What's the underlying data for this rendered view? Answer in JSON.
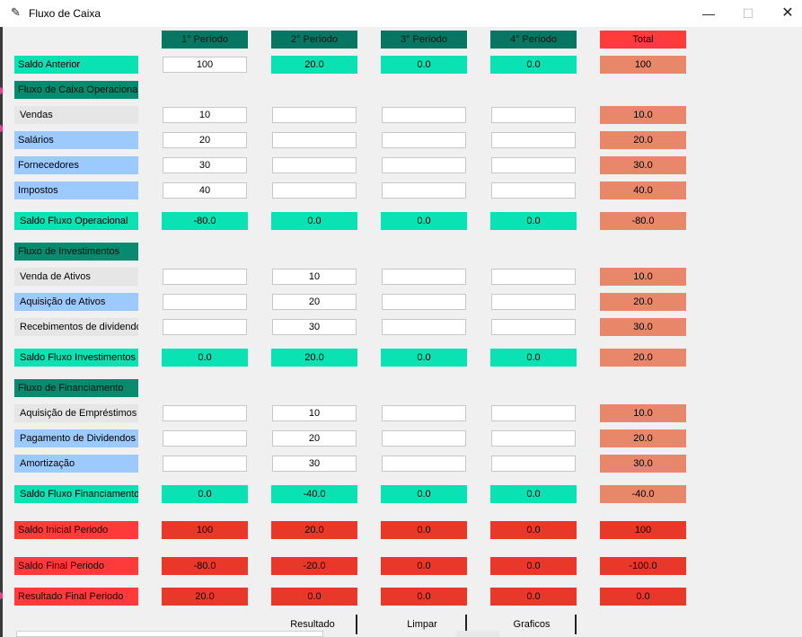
{
  "window": {
    "title": "Fluxo de Caixa",
    "minimize_glyph": "—",
    "maximize_glyph": "☐",
    "close_glyph": "✕",
    "icon": "feather-icon"
  },
  "header": {
    "periods": [
      "1° Período",
      "2° Período",
      "3° Período",
      "4° Período"
    ],
    "total": "Total"
  },
  "saldo_anterior": {
    "label": "Saldo Anterior",
    "p1_input": "100",
    "p2": "20.0",
    "p3": "0.0",
    "p4": "0.0",
    "total": "100"
  },
  "operacional": {
    "section": "Fluxo de Caixa Operacional",
    "rows": [
      {
        "label": "Vendas",
        "inputs": [
          "10",
          "",
          "",
          ""
        ],
        "total": "10.0"
      },
      {
        "label": "Salários",
        "inputs": [
          "20",
          "",
          "",
          ""
        ],
        "total": "20.0"
      },
      {
        "label": "Fornecedores",
        "inputs": [
          "30",
          "",
          "",
          ""
        ],
        "total": "30.0"
      },
      {
        "label": "Impostos",
        "inputs": [
          "40",
          "",
          "",
          ""
        ],
        "total": "40.0"
      }
    ],
    "saldo": {
      "label": "Saldo Fluxo Operacional",
      "values": [
        "-80.0",
        "0.0",
        "0.0",
        "0.0"
      ],
      "total": "-80.0"
    }
  },
  "investimentos": {
    "section": "Fluxo de Investimentos",
    "rows": [
      {
        "label": "Venda de Ativos",
        "inputs": [
          "",
          "10",
          "",
          ""
        ],
        "total": "10.0"
      },
      {
        "label": "Aquisição de Ativos",
        "inputs": [
          "",
          "20",
          "",
          ""
        ],
        "total": "20.0"
      },
      {
        "label": "Recebimentos de dividendo",
        "inputs": [
          "",
          "30",
          "",
          ""
        ],
        "total": "30.0"
      }
    ],
    "saldo": {
      "label": "Saldo Fluxo Investimentos",
      "values": [
        "0.0",
        "20.0",
        "0.0",
        "0.0"
      ],
      "total": "20.0"
    }
  },
  "financiamento": {
    "section": "Fluxo de Financiamento",
    "rows": [
      {
        "label": "Aquisição de Empréstimos",
        "inputs": [
          "",
          "10",
          "",
          ""
        ],
        "total": "10.0"
      },
      {
        "label": "Pagamento de Dividendos",
        "inputs": [
          "",
          "20",
          "",
          ""
        ],
        "total": "20.0"
      },
      {
        "label": "Amortização",
        "inputs": [
          "",
          "30",
          "",
          ""
        ],
        "total": "30.0"
      }
    ],
    "saldo": {
      "label": "Saldo Fluxo Financiamento",
      "values": [
        "0.0",
        "-40.0",
        "0.0",
        "0.0"
      ],
      "total": "-40.0"
    }
  },
  "resumo": [
    {
      "label": "Saldo Inicial Periodo",
      "values": [
        "100",
        "20.0",
        "0.0",
        "0.0"
      ],
      "total": "100"
    },
    {
      "label": "Saldo Final Periodo",
      "values": [
        "-80.0",
        "-20.0",
        "0.0",
        "0.0"
      ],
      "total": "-100.0"
    },
    {
      "label": "Resultado Final Periodo",
      "values": [
        "20.0",
        "0.0",
        "0.0",
        "0.0"
      ],
      "total": "0.0"
    }
  ],
  "buttons": {
    "resultado": "Resultado",
    "limpar": "Limpar",
    "graficos": "Graficos"
  },
  "colors": {
    "header": "#077662",
    "total_header": "#ff3b3b",
    "teal": "#0ae2b3",
    "salmon": "#e8876a",
    "red": "#e8382a",
    "section": "#078a6e",
    "label_gray": "#e6e6e6",
    "label_blue": "#9ccaff"
  }
}
